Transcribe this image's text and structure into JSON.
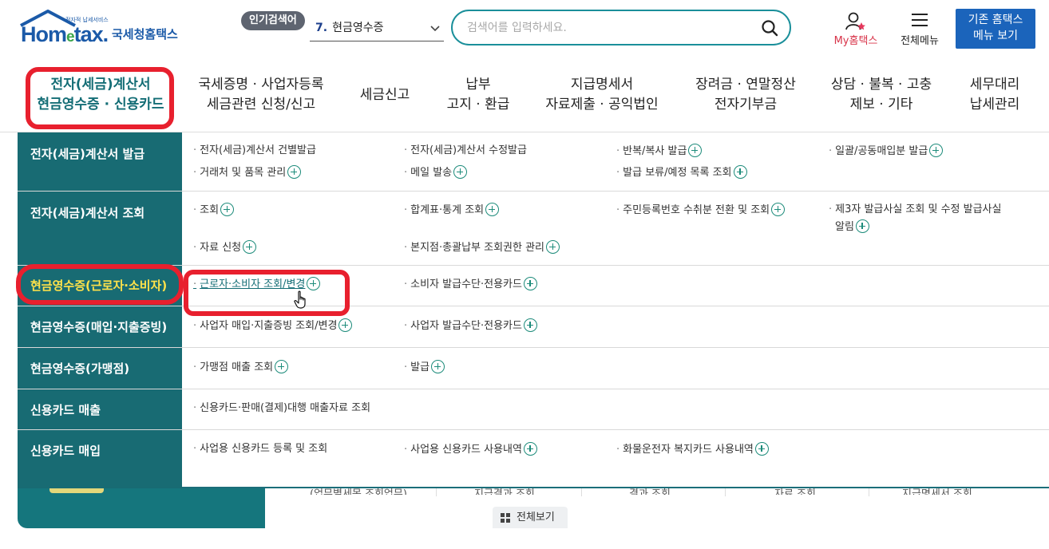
{
  "header": {
    "logo_small": "전자적 납세서비스",
    "logo_word_a": "Hom",
    "logo_word_e": "e",
    "logo_word_b": "tax.",
    "logo_kr": "국세청홈택스",
    "popular_badge": "인기검색어",
    "popular_num": "7.",
    "popular_term": "현금영수증",
    "search_placeholder": "검색어를 입력하세요.",
    "my_label": "My홈택스",
    "allmenu_label": "전체메뉴",
    "old_line1": "기존 홈택스",
    "old_line2": "메뉴 보기"
  },
  "gnb": [
    {
      "l1": "전자(세금)계산서",
      "l2": "현금영수증 · 신용카드"
    },
    {
      "l1": "국세증명 · 사업자등록",
      "l2": "세금관련 신청/신고"
    },
    {
      "l1": "세금신고",
      "l2": ""
    },
    {
      "l1": "납부",
      "l2": "고지 · 환급"
    },
    {
      "l1": "지급명세서",
      "l2": "자료제출 · 공익법인"
    },
    {
      "l1": "장려금 · 연말정산",
      "l2": "전자기부금"
    },
    {
      "l1": "상담 · 불복 · 고충",
      "l2": "제보 · 기타"
    },
    {
      "l1": "세무대리",
      "l2": "납세관리"
    }
  ],
  "mega": {
    "rows": [
      {
        "cat": "전자(세금)계산서 발급",
        "items": [
          "전자(세금)계산서 건별발급",
          "전자(세금)계산서 수정발급",
          "반복/복사 발급",
          "일괄/공동매입분 발급",
          "거래처 및 품목 관리",
          "메일 발송",
          "발급 보류/예정 목록 조회"
        ]
      },
      {
        "cat": "전자(세금)계산서 조회",
        "items": [
          "조회",
          "합계표·통계 조회",
          "주민등록번호 수취분 전환 및 조회",
          "제3자 발급사실 조회 및 수정 발급사실",
          "알림",
          "자료 신청",
          "본지점·총괄납부 조회권한 관리"
        ]
      },
      {
        "cat": "현금영수증(근로자·소비자)",
        "items": [
          "근로자·소비자 조회/변경",
          "소비자 발급수단·전용카드"
        ]
      },
      {
        "cat": "현금영수증(매입·지출증빙)",
        "items": [
          "사업자 매입·지출증빙 조회/변경",
          "사업자 발급수단·전용카드"
        ]
      },
      {
        "cat": "현금영수증(가맹점)",
        "items": [
          "가맹점 매출 조회",
          "발급"
        ]
      },
      {
        "cat": "신용카드 매출",
        "items": [
          "신용카드·판매(결제)대행 매출자료 조회"
        ]
      },
      {
        "cat": "신용카드 매입",
        "items": [
          "사업용 신용카드 등록 및 조회",
          "사업용 신용카드 사용내역",
          "화물운전자 복지카드 사용내역"
        ]
      }
    ]
  },
  "under": {
    "q1": "(업무별세목 조회업무)",
    "q2": "지급결과 조회",
    "q3": "결과 조회",
    "q4": "자료 조회",
    "q5": "지급명세서 조회",
    "view_all": "전체보기"
  },
  "colors": {
    "teal": "#186b73",
    "highlight_text": "#ffe24a",
    "red_annotation": "#e8202e",
    "brand_blue": "#1b64bb"
  }
}
